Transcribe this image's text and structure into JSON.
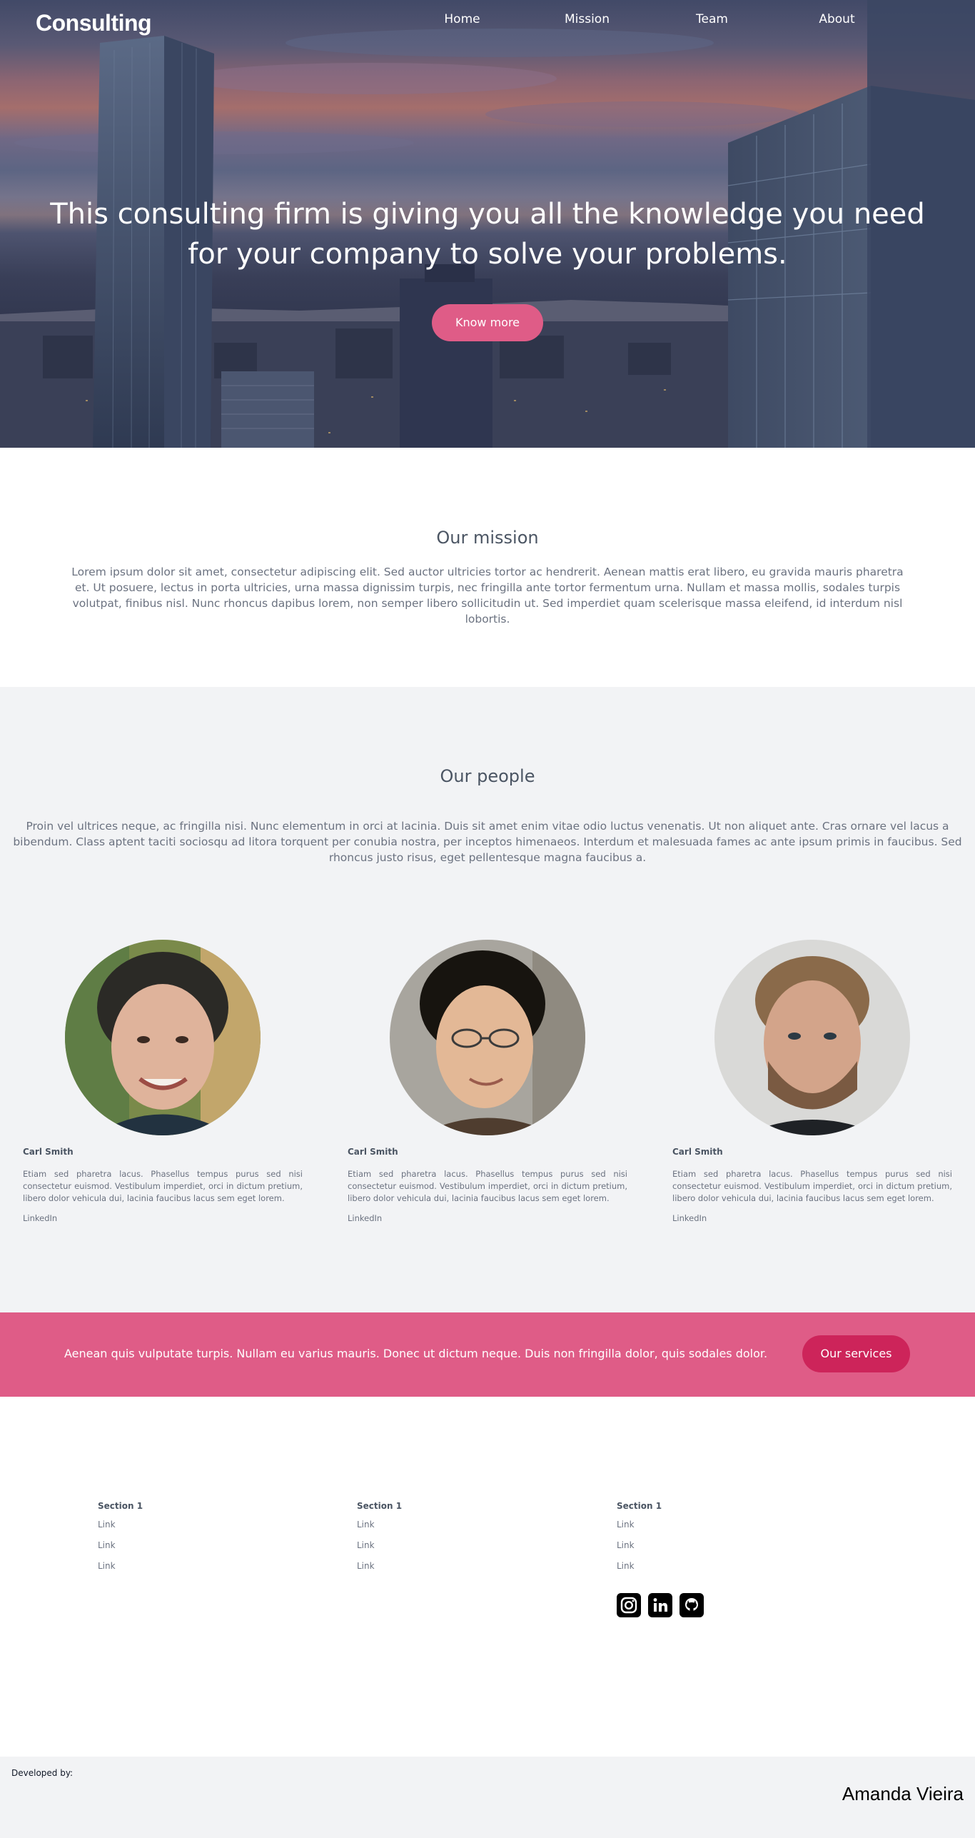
{
  "nav": {
    "logo": "Consulting",
    "links": [
      "Home",
      "Mission",
      "Team",
      "About"
    ]
  },
  "hero": {
    "title": "This consulting firm is giving you all the knowledge you need for your company to solve your problems.",
    "button": "Know more"
  },
  "mission": {
    "title": "Our mission",
    "text": "Lorem ipsum dolor sit amet, consectetur adipiscing elit. Sed auctor ultricies tortor ac hendrerit. Aenean mattis erat libero, eu gravida mauris pharetra et. Ut posuere, lectus in porta ultricies, urna massa dignissim turpis, nec fringilla ante tortor fermentum urna. Nullam et massa mollis, sodales turpis volutpat, finibus nisl. Nunc rhoncus dapibus lorem, non semper libero sollicitudin ut. Sed imperdiet quam scelerisque massa eleifend, id interdum nisl lobortis."
  },
  "people": {
    "title": "Our people",
    "intro": "Proin vel ultrices neque, ac fringilla nisi. Nunc elementum in orci at lacinia. Duis sit amet enim vitae odio luctus venenatis. Ut non aliquet ante. Cras ornare vel lacus a bibendum. Class aptent taciti sociosqu ad litora torquent per conubia nostra, per inceptos himenaeos. Interdum et malesuada fames ac ante ipsum primis in faucibus. Sed rhoncus justo risus, eget pellentesque magna faucibus a.",
    "members": [
      {
        "name": "Carl Smith",
        "bio": "Etiam sed pharetra lacus. Phasellus tempus purus sed nisi consectetur euismod. Vestibulum imperdiet, orci in dictum pretium, libero dolor vehicula dui, lacinia faucibus lacus sem eget lorem.",
        "link": "LinkedIn"
      },
      {
        "name": "Carl Smith",
        "bio": "Etiam sed pharetra lacus. Phasellus tempus purus sed nisi consectetur euismod. Vestibulum imperdiet, orci in dictum pretium, libero dolor vehicula dui, lacinia faucibus lacus sem eget lorem.",
        "link": "LinkedIn"
      },
      {
        "name": "Carl Smith",
        "bio": "Etiam sed pharetra lacus. Phasellus tempus purus sed nisi consectetur euismod. Vestibulum imperdiet, orci in dictum pretium, libero dolor vehicula dui, lacinia faucibus lacus sem eget lorem.",
        "link": "LinkedIn"
      }
    ]
  },
  "cta": {
    "text": "Aenean quis vulputate turpis. Nullam eu varius mauris. Donec ut dictum neque. Duis non fringilla dolor, quis sodales dolor.",
    "button": "Our services"
  },
  "footer": {
    "columns": [
      {
        "title": "Section 1",
        "links": [
          "Link",
          "Link",
          "Link"
        ]
      },
      {
        "title": "Section 1",
        "links": [
          "Link",
          "Link",
          "Link"
        ]
      },
      {
        "title": "Section 1",
        "links": [
          "Link",
          "Link",
          "Link"
        ]
      }
    ],
    "socials": [
      "instagram-icon",
      "linkedin-icon",
      "github-icon"
    ]
  },
  "credits": {
    "label": "Developed by:",
    "name": "Amanda Vieira"
  },
  "colors": {
    "accent": "#df5c87",
    "accent_dark": "#cd245a",
    "section_bg": "#f2f3f5",
    "text": "#4b5563"
  }
}
